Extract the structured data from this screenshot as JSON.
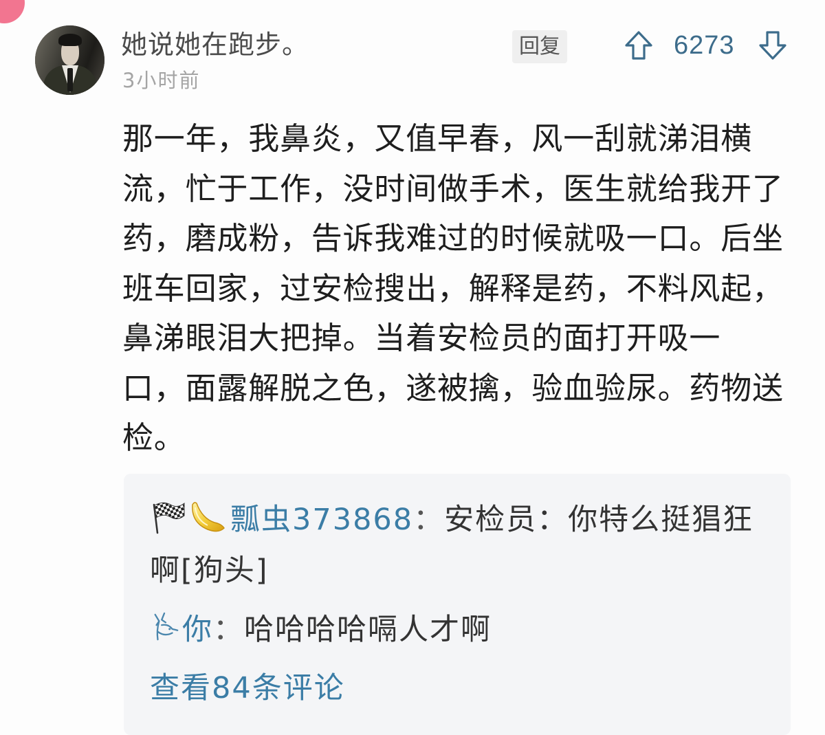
{
  "comment": {
    "author": "她说她在跑步。",
    "time": "3小时前",
    "reply_label": "回复",
    "vote_count": "6273",
    "body_lines": [
      "那一年，我鼻炎，又值早春，风一刮就涕泪横",
      "流，忙于工作，没时间做手术，医生就给我开了",
      "药，磨成粉，告诉我难过的时候就吸一口。后坐",
      "班车回家，过安检搜出，解释是药，不料风起，",
      "鼻涕眼泪大把掉。当着安检员的面打开吸一",
      "口，面露解脱之色，遂被擒，验血验尿。药物送",
      "检。"
    ]
  },
  "replies": [
    {
      "author": "瓢虫373868",
      "separator": "：",
      "text_lines": [
        "安检员：你特么挺猖狂",
        "啊[狗头]"
      ],
      "badges": [
        "checkered-flag-icon",
        "banana-badge-icon"
      ]
    },
    {
      "author": "你",
      "separator": "：",
      "text": "哈哈哈哈嗝人才啊",
      "badges": [
        "antler-badge-icon"
      ]
    }
  ],
  "view_more": "查看84条评论",
  "icons": {
    "upvote": "arrow-up-outline-icon",
    "downvote": "arrow-down-outline-icon",
    "corner": "pink-badge-icon"
  },
  "colors": {
    "text": "#1e1e1e",
    "author": "#4b4b4b",
    "muted": "#a5a5a5",
    "link": "#3b7da6",
    "vote": "#3d6c8b",
    "reply_box_bg": "#f4f5f7",
    "reply_button_bg": "#efefef",
    "corner_badge": "#f27590"
  }
}
